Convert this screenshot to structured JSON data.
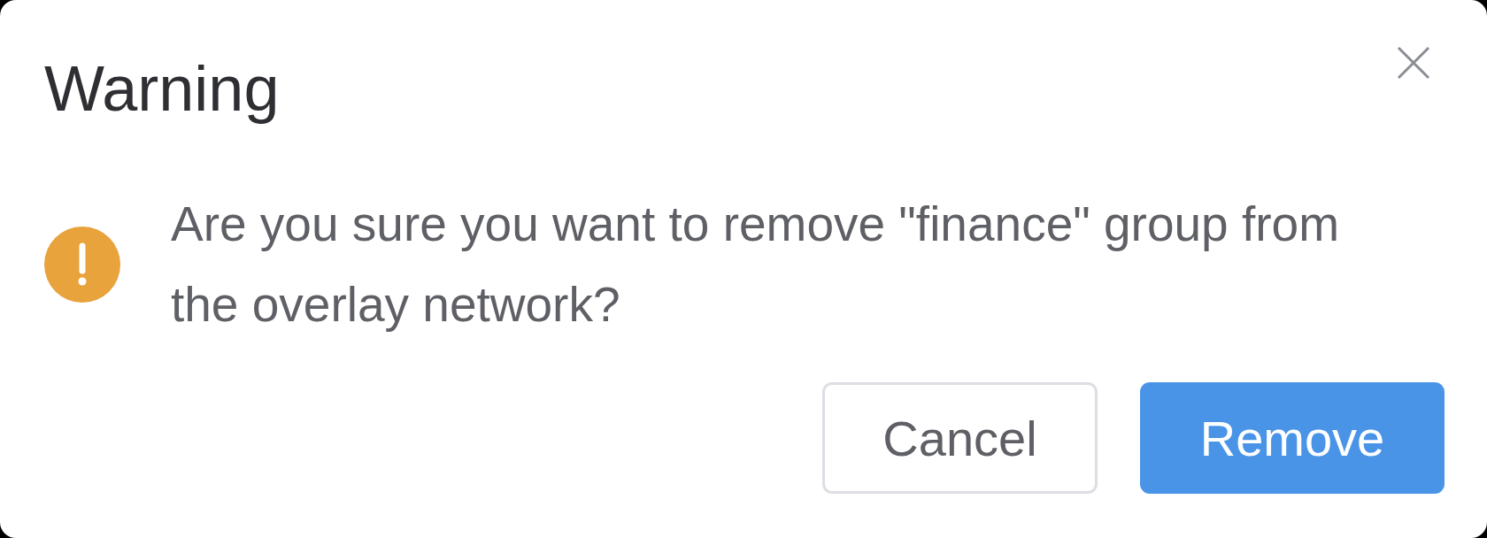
{
  "dialog": {
    "title": "Warning",
    "message": "Are you sure you want to remove \"finance\" group from the overlay network?",
    "buttons": [
      {
        "label": "Cancel",
        "kind": "secondary"
      },
      {
        "label": "Remove",
        "kind": "primary"
      }
    ]
  }
}
